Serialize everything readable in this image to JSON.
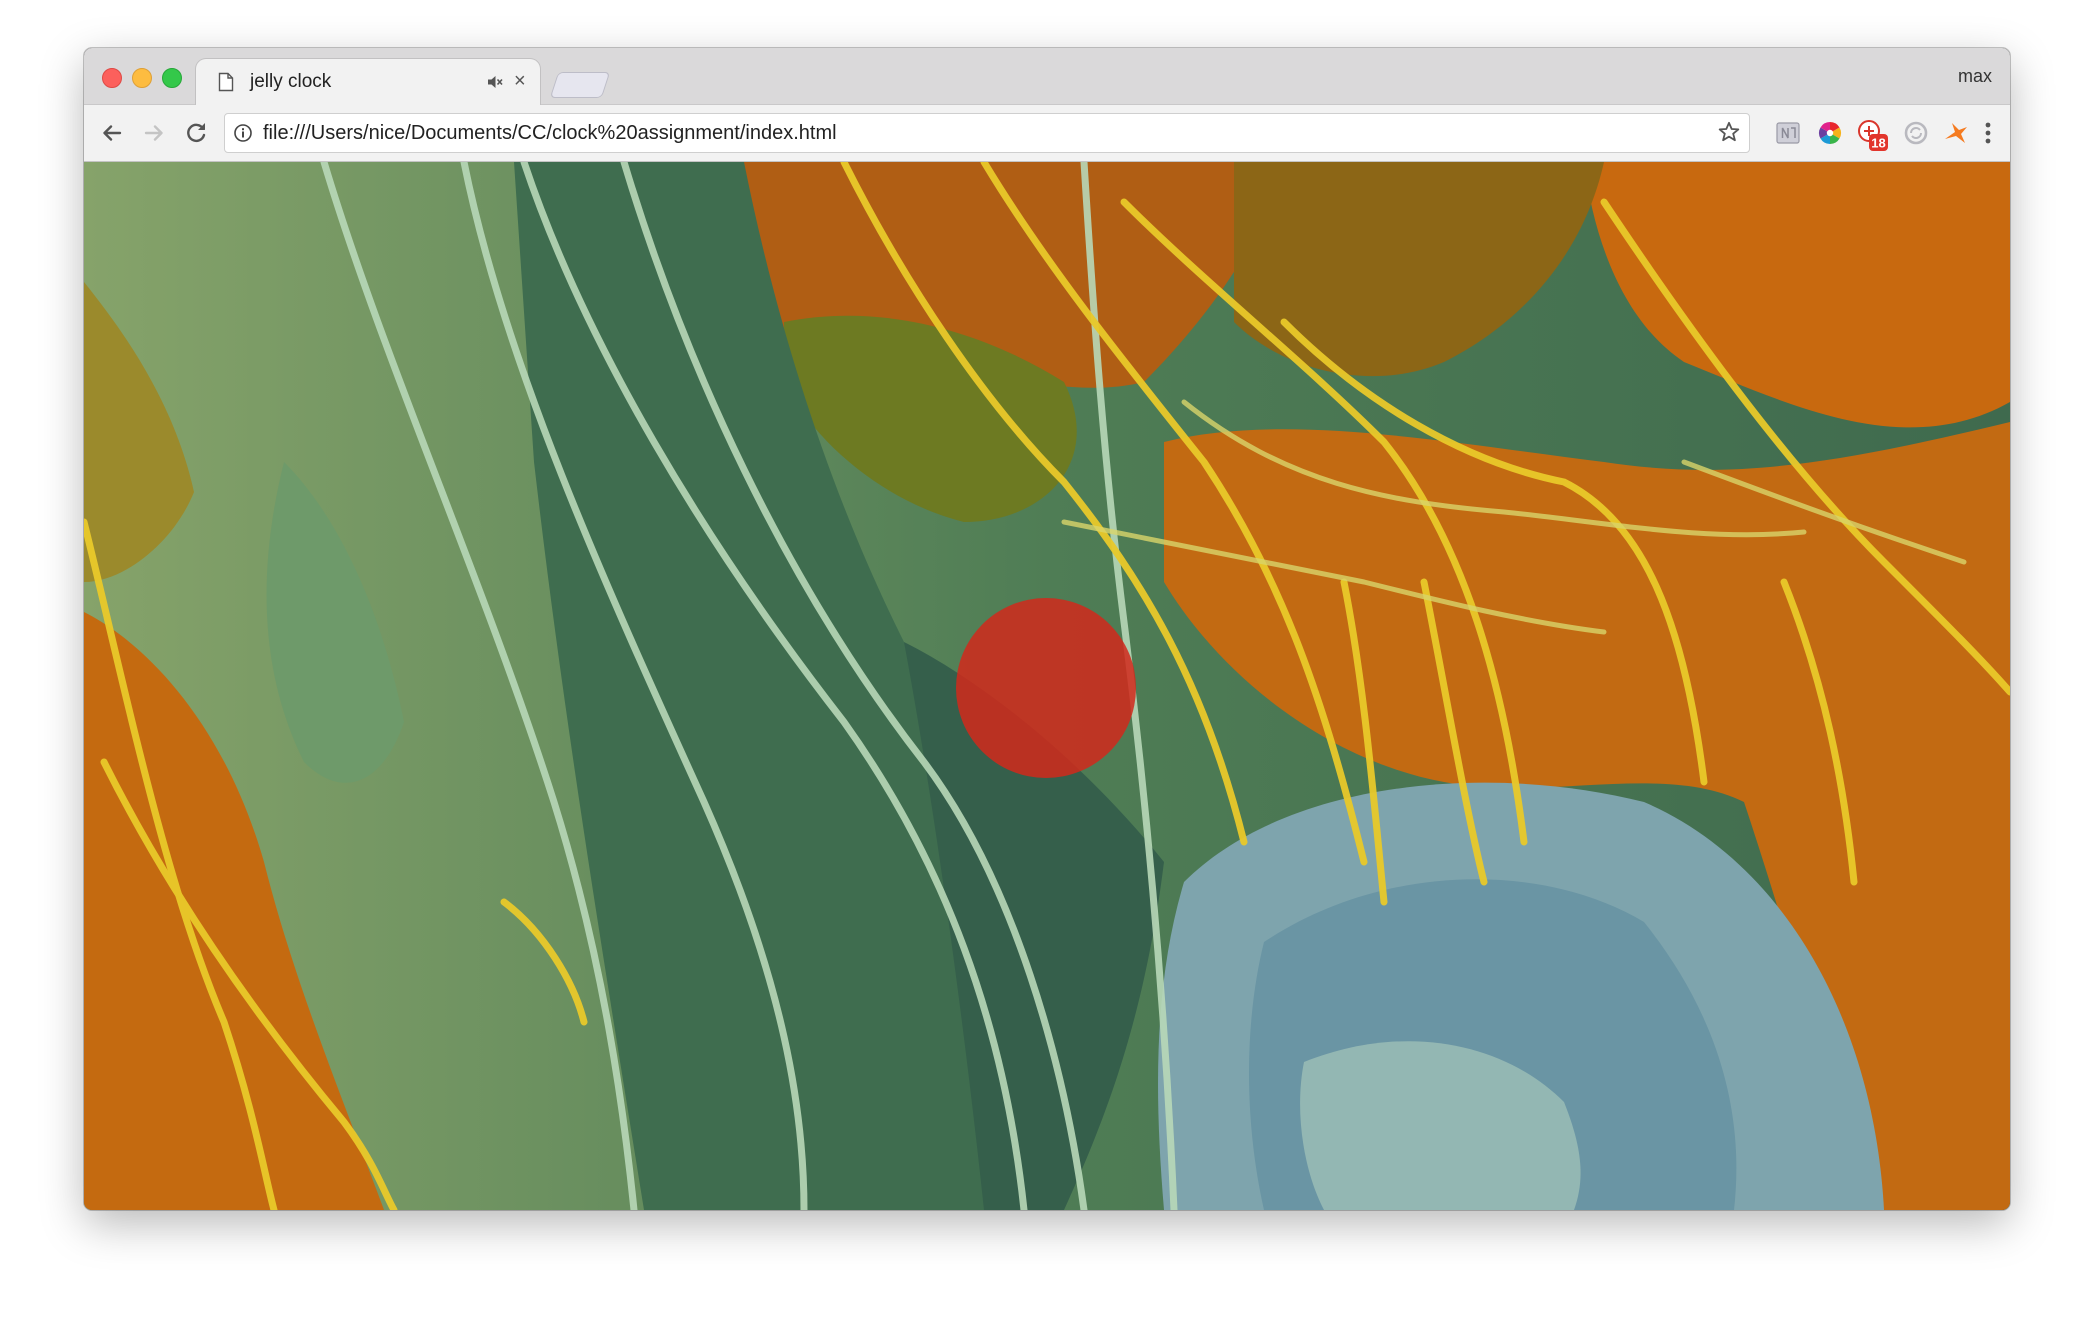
{
  "window": {
    "profile_name": "max"
  },
  "tab": {
    "title": "jelly clock",
    "icon": "page-icon",
    "mute_icon": "speaker-muted-icon",
    "close_icon": "close-icon"
  },
  "toolbar": {
    "url": "file:///Users/nice/Documents/CC/clock%20assignment/index.html",
    "back_icon": "arrow-left-icon",
    "forward_icon": "arrow-right-icon",
    "reload_icon": "reload-icon",
    "info_icon": "info-icon",
    "bookmark_icon": "star-icon",
    "extensions": [
      {
        "name": "extension-n-icon"
      },
      {
        "name": "color-wheel-icon"
      },
      {
        "name": "notification-icon",
        "badge": "18"
      },
      {
        "name": "sync-icon"
      },
      {
        "name": "orange-bird-icon"
      }
    ],
    "menu_icon": "more-vertical-icon"
  },
  "content": {
    "background": "jellyfish-posterized-image",
    "clock_dot_color": "#d02a1c"
  }
}
